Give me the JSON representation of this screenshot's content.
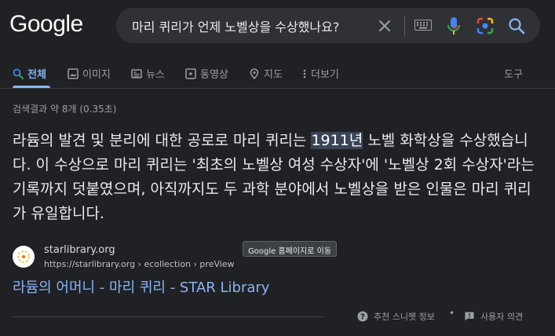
{
  "logo": "Google",
  "search": {
    "query": "마리 퀴리가 언제 노벨상을 수상했나요?"
  },
  "tabs": [
    {
      "label": "전체",
      "icon": "search-icon"
    },
    {
      "label": "이미지",
      "icon": "image-icon"
    },
    {
      "label": "뉴스",
      "icon": "news-icon"
    },
    {
      "label": "동영상",
      "icon": "video-icon"
    },
    {
      "label": "지도",
      "icon": "location-pin-icon"
    },
    {
      "label": "더보기",
      "icon": "more-vert-icon"
    }
  ],
  "tools_label": "도구",
  "stats": "검색결과 약 8개 (0.35초)",
  "answer": {
    "before": "라듐의 발견 및 분리에 대한 공로로 마리 퀴리는 ",
    "highlight": "1911년",
    "after": " 노벨 화학상을 수상했습니다. 이 수상으로 마리 퀴리는 '최초의 노벨상 여성 수상자'에 '노벨상 2회 수상자'라는 기록까지 덧붙였으며, 아직까지도 두 과학 분야에서 노벨상을 받은 인물은 마리 퀴리가 유일합니다."
  },
  "result": {
    "site_name": "starlibrary.org",
    "url": "https://starlibrary.org › ecollection › preView",
    "title": "라듐의 어머니 - 마리 퀴리 - STAR Library"
  },
  "tooltip": "Google 홈페이지로 이동",
  "footer": {
    "snippet_info": "추천 스니펫 정보",
    "feedback": "사용자 의견"
  },
  "colors": {
    "background": "#202124",
    "link": "#8ab4f8",
    "highlight": "#394457",
    "mic": "#4285f4"
  }
}
